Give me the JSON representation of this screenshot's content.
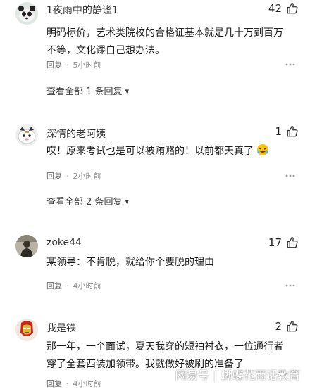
{
  "comments": [
    {
      "username": "1夜雨中的静谧1",
      "likes": "42",
      "text": "明码标价，艺术类院校的合格证基本就是几十万到百万不等，文化课自己想办法。",
      "reply_label": "回复",
      "time": "5小时前",
      "view_all": "查看全部 1 条回复"
    },
    {
      "username": "深情的老阿姨",
      "likes": "1",
      "text": "哎！原来考试也是可以被贿赂的！以前都天真了",
      "reply_label": "回复",
      "time": "2小时前",
      "view_all": "查看全部 2 条回复"
    },
    {
      "username": "zoke44",
      "likes": "17",
      "text": "某领导：不肯脱，就给你个要脱的理由",
      "reply_label": "回复",
      "time": "4小时前"
    },
    {
      "username": "我是铁",
      "likes": "2",
      "text": "那一年，一个面试，夏天我穿的短袖衬衣，一位通行者穿了全套西装加领带。我就做好被刷的准备了",
      "reply_label": "回复",
      "time": "4小时前"
    }
  ],
  "watermark": {
    "site": "网易号",
    "author": "蝴蝶花雨话教育"
  },
  "colors": {
    "text": "#1a1a1a",
    "muted": "#8a8a8a",
    "background": "#ffffff"
  }
}
